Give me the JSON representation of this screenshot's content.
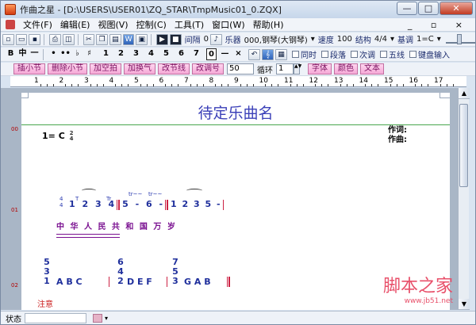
{
  "titlebar": {
    "title": "作曲之星 - [D:\\USERS\\USER01\\ZQ_STAR\\TmpMusic01_0.ZQX]",
    "min": "—",
    "max": "□",
    "close": "✕"
  },
  "menubar": {
    "items": [
      "文件(F)",
      "编辑(E)",
      "视图(V)",
      "控制(C)",
      "工具(T)",
      "窗口(W)",
      "帮助(H)"
    ],
    "mdi": "_ ▫ ×"
  },
  "toolbar1": {
    "tempo_label": "间隔",
    "tempo_value": "0",
    "instrument_label": "乐器",
    "instrument_value": "000,钢琴(大钢琴)",
    "speed_label": "速度",
    "speed_value": "100",
    "structure_label": "结构",
    "structure_value": "4/4",
    "key_label": "基调",
    "key_value": "1=C"
  },
  "toolbar2": {
    "bold": "B",
    "mid": "中",
    "sym": "一",
    "dot1": "•",
    "dot2": "••",
    "flat": "♭",
    "sharp": "♯",
    "numbers": [
      "1",
      "2",
      "3",
      "4",
      "5",
      "6",
      "7",
      "0"
    ],
    "dash": "—",
    "cross": "×",
    "checks": [
      "同时",
      "段落",
      "次调",
      "五线",
      "键盘输入"
    ]
  },
  "toolbar3": {
    "buttons": [
      "插小节",
      "删除小节",
      "加空拍",
      "加换气",
      "改节线",
      "改调号"
    ],
    "length_value": "50",
    "cycle_label": "循环",
    "cycle_value": "1",
    "buttons2": [
      "字体",
      "颜色",
      "文本"
    ]
  },
  "ruler": {
    "labels": [
      "1",
      "2",
      "3",
      "4",
      "5",
      "6",
      "7",
      "8",
      "9",
      "10",
      "11",
      "12",
      "13",
      "14",
      "15",
      "16",
      "17"
    ]
  },
  "document": {
    "title": "待定乐曲名",
    "key": "1=  C",
    "time_top": "2",
    "time_bottom": "4",
    "lyricist": "作词:",
    "composer": "作曲:",
    "line_numbers": [
      "00",
      "01",
      "02"
    ],
    "row1_fraction_top": "4",
    "row1_fraction_bottom": "4",
    "row1_notes_a": "1 2 3 4",
    "row1_notes_b": "5 - 6 -",
    "row1_notes_c": "1 2 3 5 -",
    "row1_marks": [
      "T",
      "Tr",
      "tr~~",
      "tr~~"
    ],
    "lyrics": "中 华 人 民    共   和     国 万  岁",
    "chords": [
      "5",
      "3",
      "1",
      "6",
      "4",
      "2",
      "7",
      "5",
      "3"
    ],
    "row2_letters_a": "A  B  C",
    "row2_letters_b": "D E F",
    "row2_letters_c": "G A B",
    "note_label": "注意"
  },
  "statusbar": {
    "label": "状态"
  },
  "watermark": {
    "text": "脚本之家",
    "url": "www.jb51.net"
  }
}
